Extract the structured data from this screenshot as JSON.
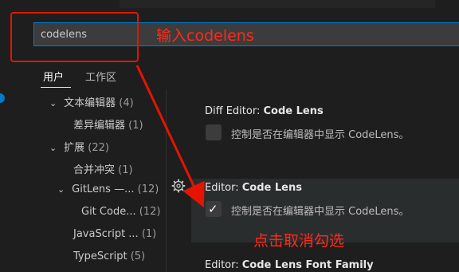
{
  "search": {
    "value": "codelens",
    "placeholder": ""
  },
  "annotations": {
    "input_hint": "输入codelens",
    "uncheck_hint": "点击取消勾选"
  },
  "tabs": [
    {
      "label": "用户",
      "active": true
    },
    {
      "label": "工作区",
      "active": false
    }
  ],
  "tree": {
    "items": [
      {
        "label": "文本编辑器",
        "count": "(4)",
        "expanded": true
      },
      {
        "label": "差异编辑器",
        "count": "(1)"
      },
      {
        "label": "扩展",
        "count": "(22)",
        "expanded": true
      },
      {
        "label": "合并冲突",
        "count": "(1)"
      },
      {
        "label": "GitLens —...",
        "count": "(12)",
        "expanded": true
      },
      {
        "label": "Git Code...",
        "count": "(12)"
      },
      {
        "label": "JavaScript ...",
        "count": "(1)"
      },
      {
        "label": "TypeScript",
        "count": "(5)"
      }
    ]
  },
  "settings": [
    {
      "category": "Diff Editor: ",
      "name": "Code Lens",
      "description": "控制是否在编辑器中显示 CodeLens。",
      "checked": false
    },
    {
      "category": "Editor: ",
      "name": "Code Lens",
      "description": "控制是否在编辑器中显示 CodeLens。",
      "checked": true
    },
    {
      "category": "Editor: ",
      "name": "Code Lens Font Family"
    }
  ],
  "colors": {
    "accent": "#007acc",
    "annotation": "#e51400",
    "background": "#1e1e1e"
  }
}
